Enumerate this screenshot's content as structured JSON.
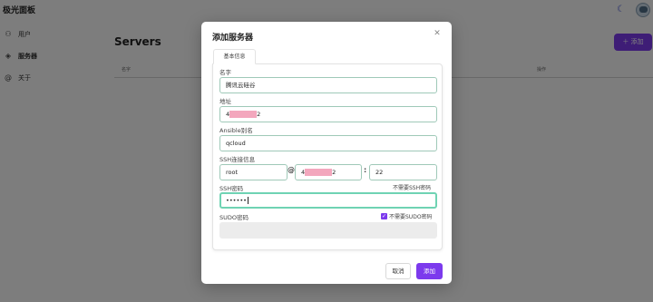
{
  "app": {
    "title": "极光面板"
  },
  "header": {
    "theme_icon": "moon-icon",
    "avatar_icon": "user-avatar"
  },
  "sidebar": {
    "items": [
      {
        "label": "用户",
        "icon": "users-icon",
        "glyph": "⚇"
      },
      {
        "label": "服务器",
        "icon": "layers-icon",
        "glyph": "◈"
      },
      {
        "label": "关于",
        "icon": "at-icon",
        "glyph": "@"
      }
    ]
  },
  "main": {
    "title": "Servers",
    "add_button": "添加",
    "add_icon": "plus-icon",
    "columns": [
      "名字",
      "操作"
    ]
  },
  "modal": {
    "title": "添加服务器",
    "close_icon": "close-icon",
    "tab": "基本信息",
    "fields": {
      "name": {
        "label": "名字",
        "value": "腾讯云硅谷"
      },
      "address": {
        "label": "地址",
        "value_start": "4",
        "value_end": "2"
      },
      "ansible_alias": {
        "label": "Ansible别名",
        "value": "qcloud"
      },
      "ssh": {
        "label": "SSH连接信息",
        "user": "root",
        "at": "@",
        "host_start": "4",
        "host_end": "2",
        "colon": ":",
        "port": "22"
      },
      "ssh_password": {
        "label": "SSH密码",
        "value": "••••••",
        "no_password_link": "不需要SSH密码"
      },
      "sudo_password": {
        "label": "SUDO密码",
        "checkbox_label": "不需要SUDO密码",
        "checked": true
      }
    },
    "cancel_button": "取消",
    "submit_button": "添加"
  },
  "colors": {
    "accent": "#7c3aed",
    "focus_border": "#6fd3b3",
    "input_border": "#9fc9b8",
    "mask": "#f3a7bd"
  }
}
